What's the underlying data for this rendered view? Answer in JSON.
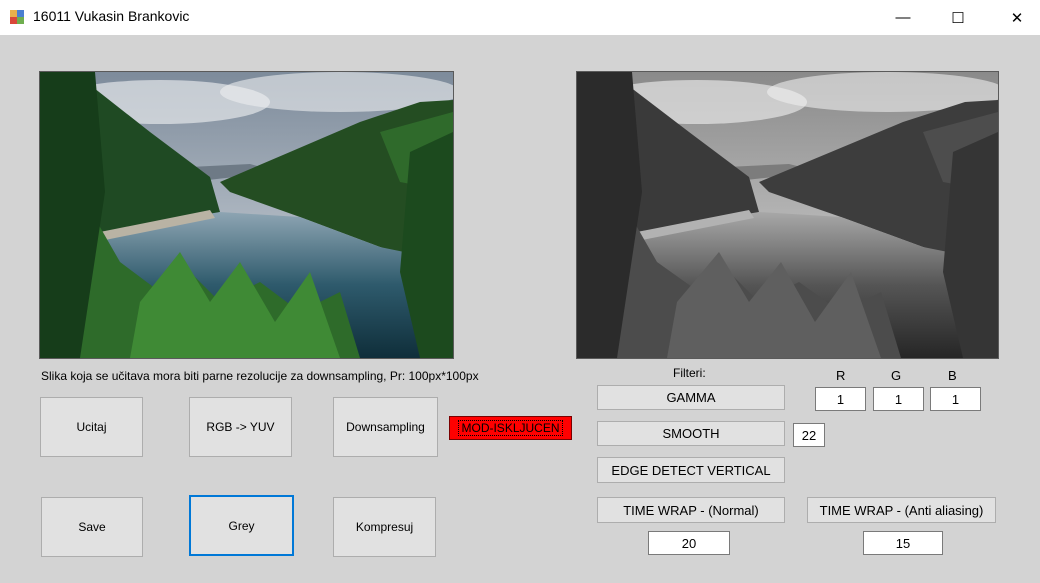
{
  "window": {
    "title": "16011 Vukasin Brankovic",
    "minimize_glyph": "—",
    "maximize_glyph": "☐",
    "close_glyph": "✕"
  },
  "images": {
    "original": {
      "description": "color landscape",
      "tone": "color"
    },
    "processed": {
      "description": "grayscale landscape",
      "tone": "grey"
    }
  },
  "info_label": "Slika koja se učitava mora biti parne rezolucije za downsampling, Pr: 100px*100px",
  "buttons": {
    "ucitaj": "Ucitaj",
    "rgb_yuv": "RGB -> YUV",
    "downsampling": "Downsampling",
    "save": "Save",
    "grey": "Grey",
    "kompresuj": "Kompresuj"
  },
  "mode_label": "MOD-ISKLJUCEN",
  "filters": {
    "title": "Filteri:",
    "gamma": "GAMMA",
    "smooth": "SMOOTH",
    "edge": "EDGE DETECT VERTICAL",
    "time_wrap_normal": "TIME WRAP - (Normal)",
    "time_wrap_anti": "TIME WRAP - (Anti aliasing)"
  },
  "rgb": {
    "r_label": "R",
    "g_label": "G",
    "b_label": "B",
    "r_value": "1",
    "g_value": "1",
    "b_value": "1"
  },
  "smooth_value": "22",
  "time_wrap_normal_value": "20",
  "time_wrap_anti_value": "15",
  "colors": {
    "client_bg": "#d3d3d3",
    "mode_red": "#ff0000",
    "focus_blue": "#0078d7"
  }
}
